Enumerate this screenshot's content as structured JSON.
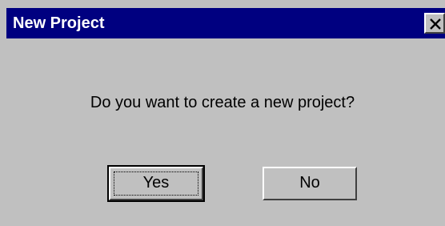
{
  "window": {
    "title": "New Project",
    "close_icon": "close-icon"
  },
  "message": {
    "text": "Do you want to create a new project?"
  },
  "buttons": {
    "yes_label": "Yes",
    "no_label": "No",
    "default": "yes"
  },
  "colors": {
    "titlebar": "#000080",
    "dialog_face": "#c0c0c0",
    "title_text": "#ffffff"
  }
}
